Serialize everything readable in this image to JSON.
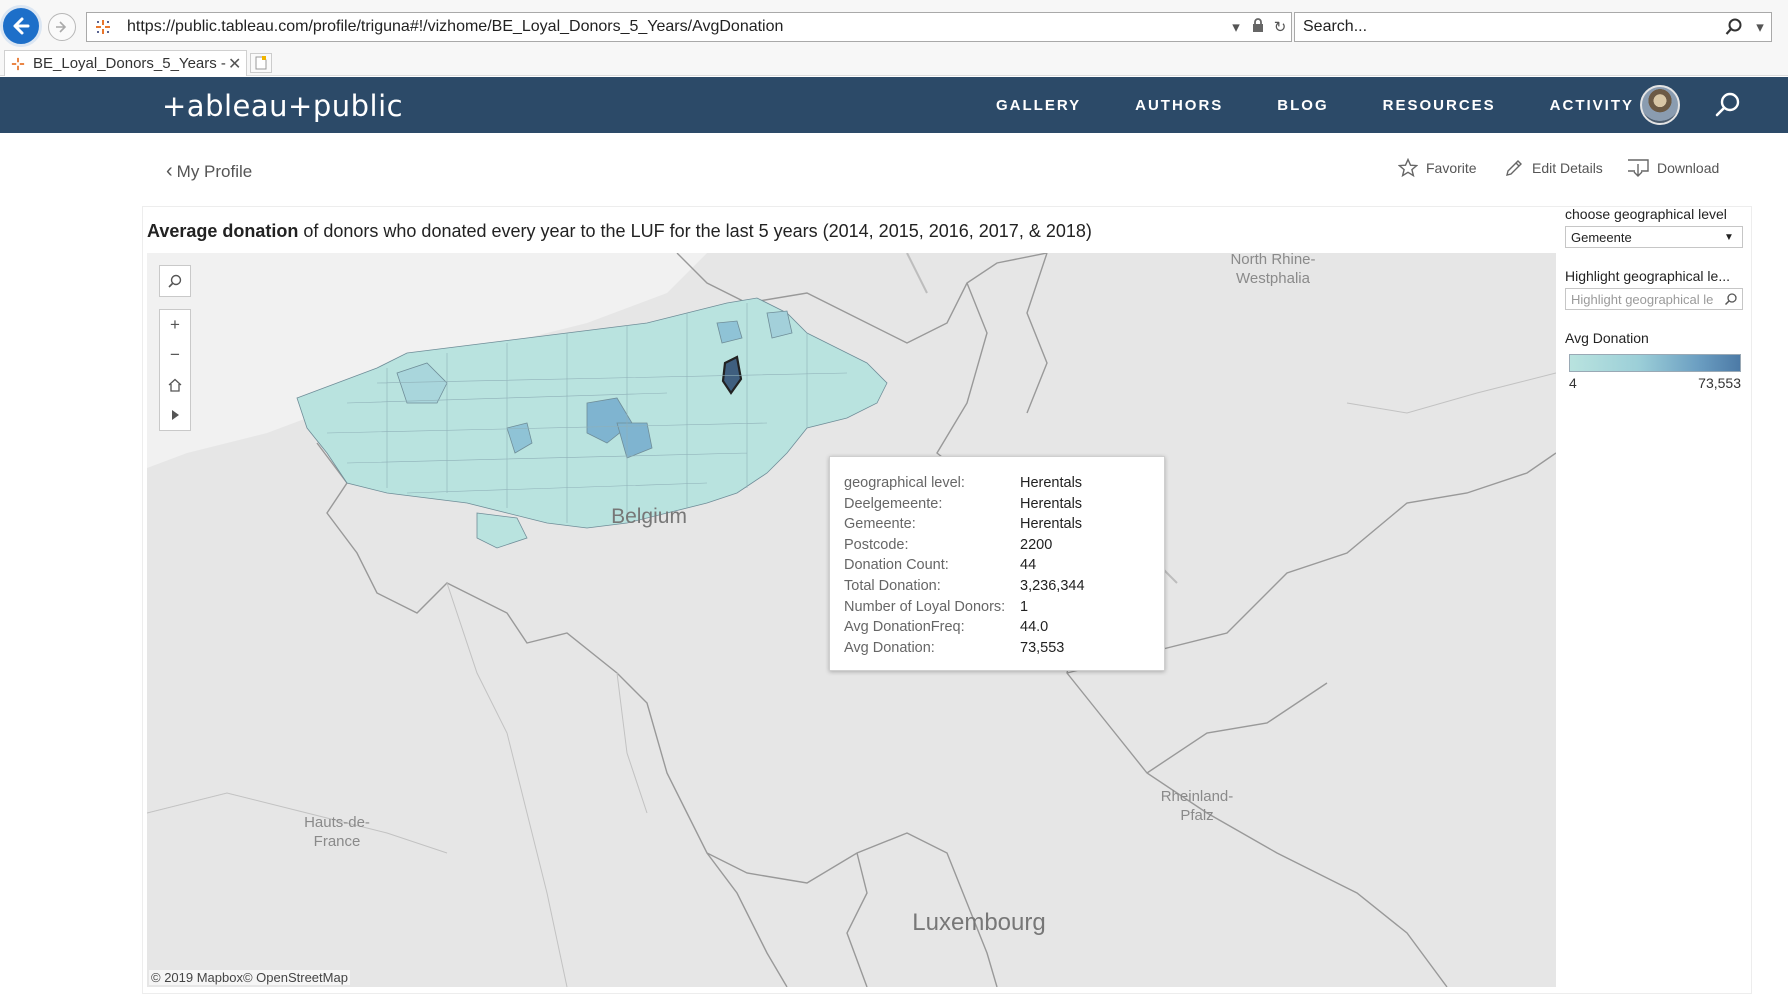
{
  "browser": {
    "url": "https://public.tableau.com/profile/triguna#!/vizhome/BE_Loyal_Donors_5_Years/AvgDonation",
    "search_placeholder": "Search...",
    "tab_title": "BE_Loyal_Donors_5_Years - ..."
  },
  "header": {
    "logo": "+ableau+public",
    "nav": [
      "GALLERY",
      "AUTHORS",
      "BLOG",
      "RESOURCES",
      "ACTIVITY"
    ]
  },
  "toolbar": {
    "back_label": "My Profile",
    "favorite_label": "Favorite",
    "edit_label": "Edit Details",
    "download_label": "Download"
  },
  "viz": {
    "title_bold": "Average donation",
    "title_rest": " of donors who donated every year to the LUF for the last 5 years (2014, 2015, 2016, 2017, & 2018)",
    "map_labels": {
      "nrw": "North Rhine-\nWestphalia",
      "belgium": "Belgium",
      "hauts": "Hauts-de-\nFrance",
      "rheinland": "Rheinland-\nPfalz",
      "luxembourg": "Luxembourg"
    },
    "attribution": "© 2019 Mapbox© OpenStreetMap",
    "tooltip": [
      {
        "key": "geographical level:",
        "value": "Herentals"
      },
      {
        "key": "Deelgemeente:",
        "value": "Herentals"
      },
      {
        "key": "Gemeente:",
        "value": "Herentals"
      },
      {
        "key": "Postcode:",
        "value": "2200"
      },
      {
        "key": "Donation Count:",
        "value": "44"
      },
      {
        "key": "Total Donation:",
        "value": "3,236,344"
      },
      {
        "key": "Number of Loyal Donors:",
        "value": "1"
      },
      {
        "key": "Avg DonationFreq:",
        "value": "44.0"
      },
      {
        "key": "Avg Donation:",
        "value": "73,553"
      }
    ]
  },
  "side_panel": {
    "geo_level_label": "choose geographical level",
    "geo_level_value": "Gemeente",
    "highlight_label": "Highlight geographical le...",
    "highlight_placeholder": "Highlight geographical le",
    "legend_title": "Avg Donation",
    "legend_min": "4",
    "legend_max": "73,553",
    "legend_colors": [
      "#b9e3df",
      "#4c7aa6"
    ]
  },
  "colors": {
    "header_bg": "#2c4a68",
    "region_fill": "#b9e3df",
    "region_highlight": "#3f5f7f",
    "region_mid": "#7fb4d0"
  }
}
